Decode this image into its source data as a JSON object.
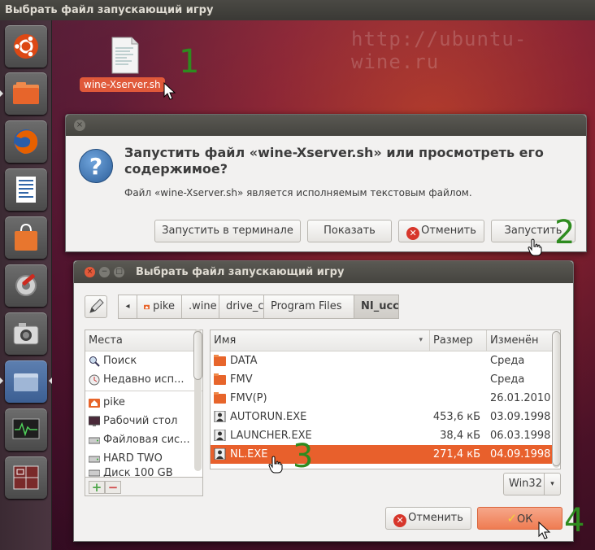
{
  "top_panel": {
    "title": "Выбрать файл запускающий игру"
  },
  "watermark": "http://ubuntu-wine.ru",
  "desktop_file": {
    "label": "wine-Xserver.sh"
  },
  "steps": [
    "1",
    "2",
    "3",
    "4"
  ],
  "run_dialog": {
    "close_glyph": "×",
    "heading": "Запустить файл «wine-Xserver.sh» или просмотреть его содержимое?",
    "subtext": "Файл «wine-Xserver.sh» является исполняемым текстовым файлом.",
    "question_glyph": "?",
    "buttons": {
      "run_in_terminal": "Запустить в терминале",
      "show": "Показать",
      "cancel": "Отменить",
      "run": "Запустить"
    }
  },
  "file_chooser": {
    "title": "Выбрать файл запускающий игру",
    "path_back_glyph": "◂",
    "path": [
      "pike",
      ".wine",
      "drive_c",
      "Program Files",
      "NI_ucc"
    ],
    "places": {
      "header": "Места",
      "items": [
        {
          "label": "Поиск",
          "icon": "search-icon"
        },
        {
          "label": "Недавно исп...",
          "icon": "recent-icon"
        },
        {
          "label": "pike",
          "icon": "home-folder-icon"
        },
        {
          "label": "Рабочий стол",
          "icon": "desktop-icon"
        },
        {
          "label": "Файловая сис...",
          "icon": "drive-icon"
        },
        {
          "label": "HARD TWO",
          "icon": "drive-icon"
        },
        {
          "label": "Диск 100 GB",
          "icon": "drive-icon"
        }
      ],
      "add_glyph": "+",
      "remove_glyph": "−"
    },
    "columns": {
      "name": "Имя",
      "size": "Размер",
      "modified": "Изменён",
      "sort_glyph": "▾"
    },
    "files": [
      {
        "name": "DATA",
        "size": "",
        "modified": "Среда",
        "icon": "folder-icon",
        "selected": false
      },
      {
        "name": "FMV",
        "size": "",
        "modified": "Среда",
        "icon": "folder-icon",
        "selected": false
      },
      {
        "name": "FMV(P)",
        "size": "",
        "modified": "26.01.2010",
        "icon": "folder-icon",
        "selected": false
      },
      {
        "name": "AUTORUN.EXE",
        "size": "453,6 кБ",
        "modified": "03.09.1998",
        "icon": "exe-icon",
        "selected": false
      },
      {
        "name": "LAUNCHER.EXE",
        "size": "38,4 кБ",
        "modified": "06.03.1998",
        "icon": "exe-icon",
        "selected": false
      },
      {
        "name": "NL.EXE",
        "size": "271,4 кБ",
        "modified": "04.09.1998",
        "icon": "exe-icon",
        "selected": true
      }
    ],
    "filter": {
      "value": "Win32",
      "arrow_glyph": "▾"
    },
    "buttons": {
      "cancel": "Отменить",
      "ok": "ОК"
    }
  },
  "colors": {
    "accent": "#e8602c",
    "step_green": "#2e8b1f",
    "cancel_red": "#d7362b"
  }
}
